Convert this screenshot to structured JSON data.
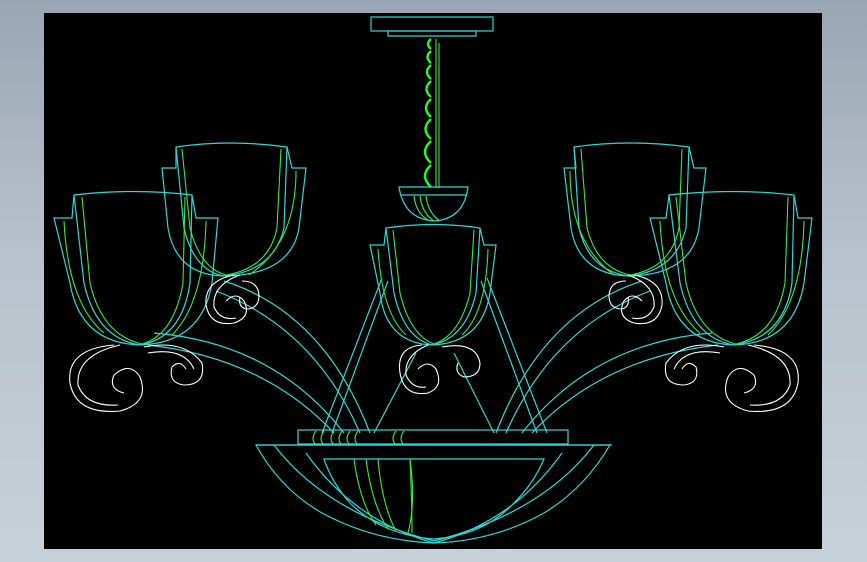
{
  "colors": {
    "background": "#000000",
    "outline": "#2fd8d8",
    "detail": "#33ee33",
    "scroll": "#ffffff",
    "frame": "#b8c2cc"
  }
}
